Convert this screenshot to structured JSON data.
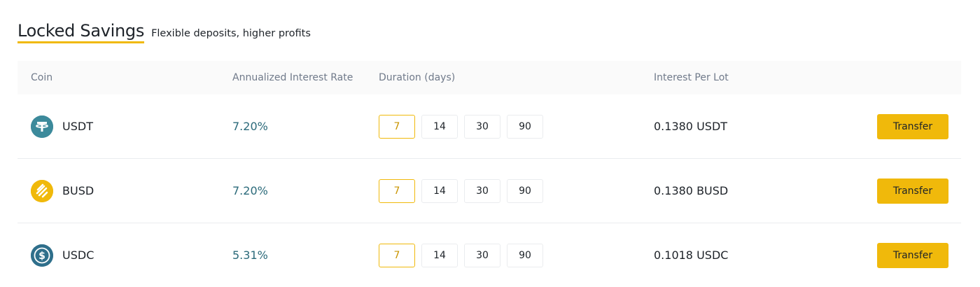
{
  "header": {
    "title": "Locked Savings",
    "subtitle": "Flexible deposits, higher profits"
  },
  "columns": {
    "coin": "Coin",
    "rate": "Annualized Interest Rate",
    "duration": "Duration (days)",
    "lot": "Interest Per Lot"
  },
  "colors": {
    "accent": "#F0B90B",
    "rate_text": "#2B6A7A",
    "usdt_icon": "#3C8A9B",
    "busd_icon": "#F0B90B",
    "usdc_icon": "#2F6F8B"
  },
  "rows": [
    {
      "coin": "USDT",
      "icon": "tether-icon",
      "rate": "7.20%",
      "durations": [
        "7",
        "14",
        "30",
        "90"
      ],
      "selected_duration": "7",
      "interest_per_lot": "0.1380 USDT",
      "action": "Transfer"
    },
    {
      "coin": "BUSD",
      "icon": "busd-icon",
      "rate": "7.20%",
      "durations": [
        "7",
        "14",
        "30",
        "90"
      ],
      "selected_duration": "7",
      "interest_per_lot": "0.1380 BUSD",
      "action": "Transfer"
    },
    {
      "coin": "USDC",
      "icon": "usdc-icon",
      "rate": "5.31%",
      "durations": [
        "7",
        "14",
        "30",
        "90"
      ],
      "selected_duration": "7",
      "interest_per_lot": "0.1018 USDC",
      "action": "Transfer"
    }
  ]
}
